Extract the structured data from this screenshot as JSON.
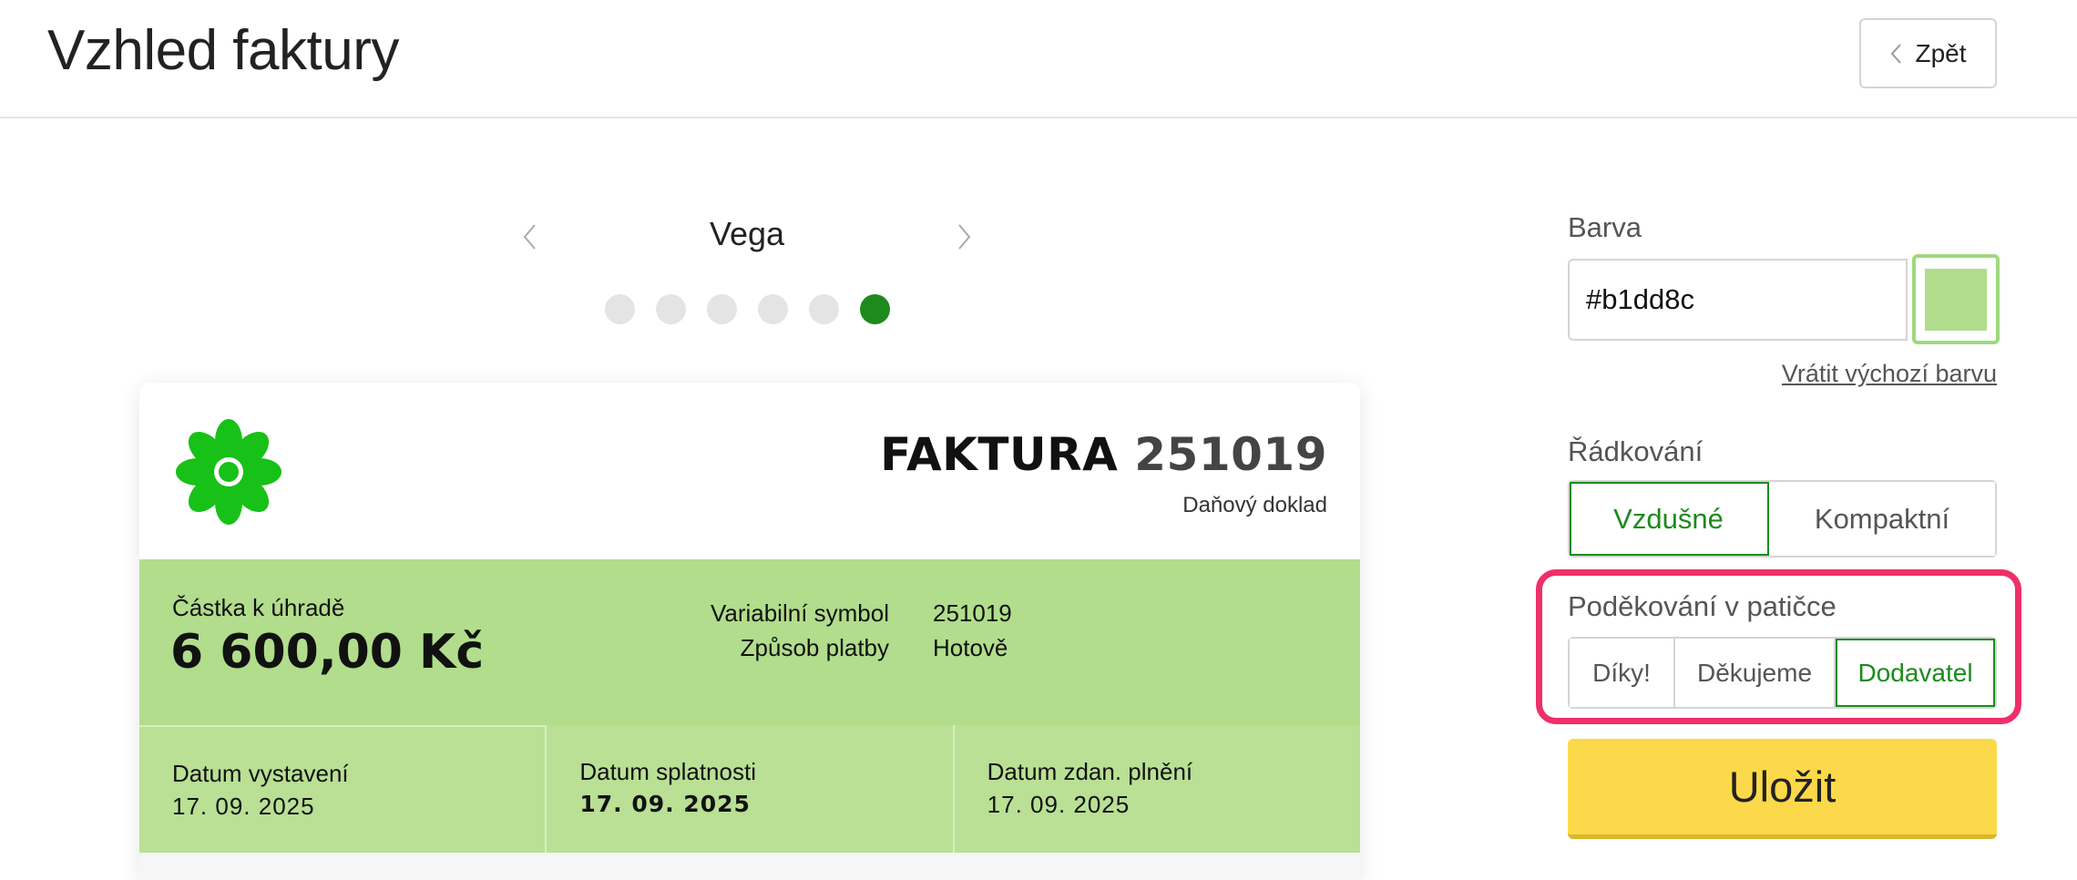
{
  "header": {
    "title": "Vzhled faktury",
    "back_label": "Zpět"
  },
  "template_switcher": {
    "name": "Vega",
    "count": 6,
    "active_index": 5
  },
  "invoice": {
    "title_word": "FAKTURA",
    "number": "251019",
    "subtitle": "Daňový doklad",
    "amount_label": "Částka k úhradě",
    "amount_value": "6 600,00 Kč",
    "details": {
      "labels": [
        "Variabilní symbol",
        "Způsob platby"
      ],
      "values": [
        "251019",
        "Hotově"
      ]
    },
    "dates": [
      {
        "label": "Datum vystavení",
        "value": "17. 09. 2025",
        "bold": false
      },
      {
        "label": "Datum splatnosti",
        "value": "17. 09. 2025",
        "bold": true
      },
      {
        "label": "Datum zdan. plnění",
        "value": "17. 09. 2025",
        "bold": false
      }
    ],
    "logo_color": "#17c117",
    "band_color": "#b1dd8c"
  },
  "settings": {
    "color_label": "Barva",
    "color_value": "#b1dd8c",
    "reset_label": "Vrátit výchozí barvu",
    "spacing_label": "Řádkování",
    "spacing_options": [
      "Vzdušné",
      "Kompaktní"
    ],
    "spacing_selected": "Vzdušné",
    "thanks_label": "Poděkování v patičce",
    "thanks_options": [
      "Díky!",
      "Děkujeme",
      "Dodavatel"
    ],
    "thanks_selected": "Dodavatel",
    "save_label": "Uložit"
  },
  "colors": {
    "accent": "#1c8a1c",
    "save": "#fcd94a",
    "highlight": "#ef2f6a"
  }
}
